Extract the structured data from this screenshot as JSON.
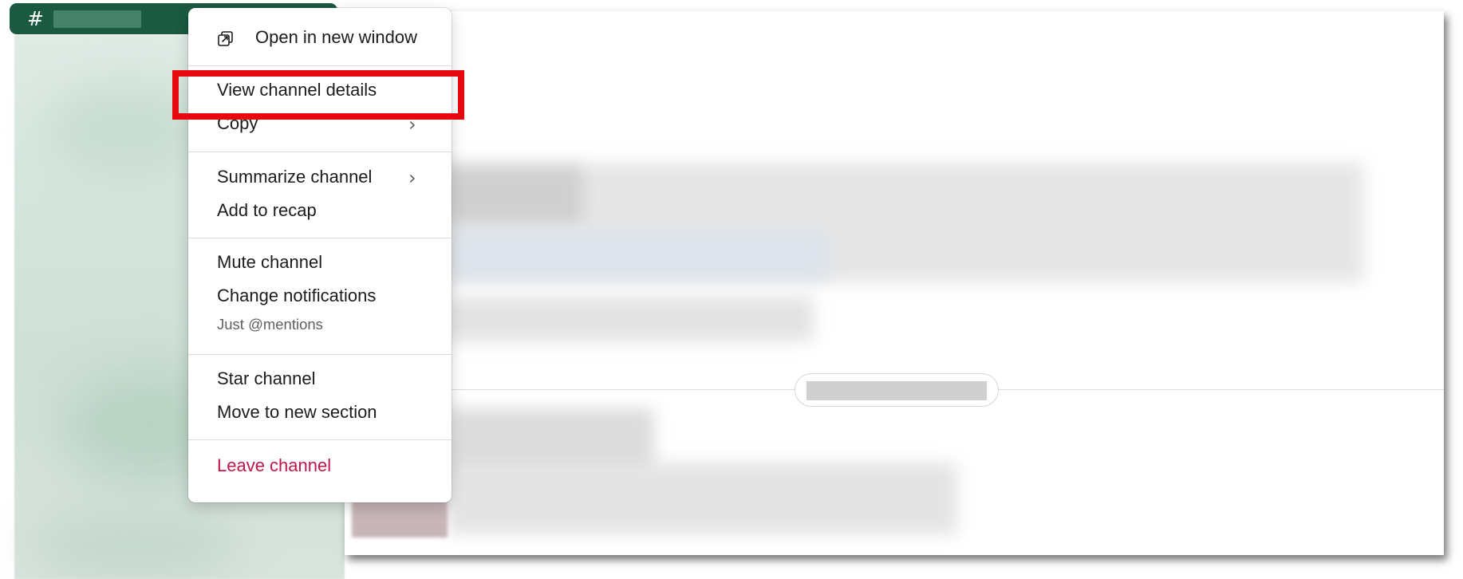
{
  "sidebar": {
    "active_channel": {
      "hash": "#",
      "name": ""
    }
  },
  "context_menu": {
    "items": [
      {
        "label": "Open in new window",
        "icon": "open-window-icon"
      },
      {
        "label": "View channel details"
      },
      {
        "label": "Copy",
        "has_submenu": true
      },
      {
        "label": "Summarize channel",
        "has_submenu": true
      },
      {
        "label": "Add to recap"
      },
      {
        "label": "Mute channel"
      },
      {
        "label": "Change notifications",
        "sublabel": "Just @mentions"
      },
      {
        "label": "Star channel"
      },
      {
        "label": "Move to new section"
      },
      {
        "label": "Leave channel",
        "style": "danger"
      }
    ],
    "chevron": "›"
  },
  "highlight": {
    "target": "View channel details",
    "color": "#e5080f"
  },
  "colors": {
    "sidebar_active": "#1a5a40",
    "danger_text": "#c0174a",
    "menu_text": "#1d1c1d",
    "muted_text": "#616061"
  }
}
